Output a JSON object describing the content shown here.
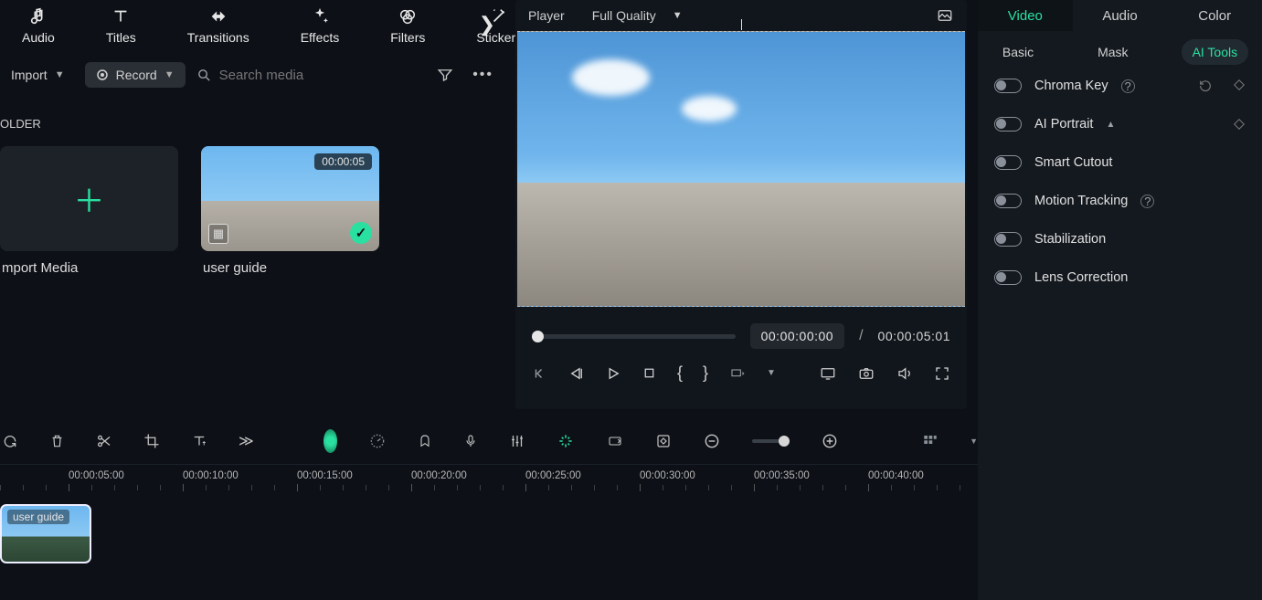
{
  "topcats": [
    {
      "label": "Audio",
      "icon": "audio"
    },
    {
      "label": "Titles",
      "icon": "titles"
    },
    {
      "label": "Transitions",
      "icon": "transitions"
    },
    {
      "label": "Effects",
      "icon": "effects"
    },
    {
      "label": "Filters",
      "icon": "filters"
    },
    {
      "label": "Stickers",
      "icon": "stickers"
    }
  ],
  "toolbar": {
    "import_label": "Import",
    "record_label": "Record",
    "search_placeholder": "Search media"
  },
  "folder_heading": "OLDER",
  "media": {
    "import_card_label": "mport Media",
    "clip": {
      "label": "user guide",
      "duration": "00:00:05"
    }
  },
  "player": {
    "title": "Player",
    "quality": "Full Quality",
    "current_time": "00:00:00:00",
    "total_time": "00:00:05:01",
    "separator": "/"
  },
  "inspector": {
    "primary_tabs": [
      "Video",
      "Audio",
      "Color"
    ],
    "active_primary": "Video",
    "secondary_tabs": [
      "Basic",
      "Mask",
      "AI Tools"
    ],
    "active_secondary": "AI Tools",
    "props": [
      {
        "label": "Chroma Key",
        "help": true,
        "icons": [
          "reset",
          "keyframe"
        ]
      },
      {
        "label": "AI Portrait",
        "caret": true,
        "icons": [
          "keyframe"
        ]
      },
      {
        "label": "Smart Cutout"
      },
      {
        "label": "Motion Tracking",
        "help": true
      },
      {
        "label": "Stabilization"
      },
      {
        "label": "Lens Correction"
      }
    ]
  },
  "timeline": {
    "ruler": [
      "00:00:05:00",
      "00:00:10:00",
      "00:00:15:00",
      "00:00:20:00",
      "00:00:25:00",
      "00:00:30:00",
      "00:00:35:00",
      "00:00:40:00"
    ],
    "clip_label": "user guide"
  }
}
